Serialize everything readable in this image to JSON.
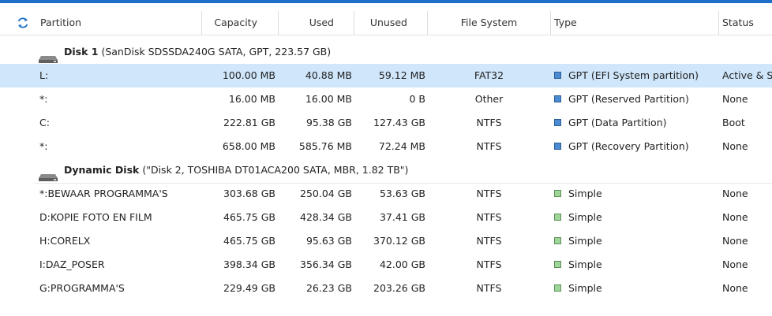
{
  "header": {
    "columns": [
      "Partition",
      "Capacity",
      "Used",
      "Unused",
      "File System",
      "Type",
      "Status"
    ]
  },
  "icons": {
    "refresh": "refresh-icon",
    "disk": "disk-drive-icon",
    "partition_type": "square-icon"
  },
  "colors": {
    "accent": "#1e6fc9",
    "gpt_square": "#4b8bd4",
    "simple_square": "#9fd79a",
    "selection": "#cfe6fb"
  },
  "disks": [
    {
      "name": "Disk 1",
      "details": "(SanDisk SDSSDA240G SATA, GPT, 223.57 GB)",
      "partitions": [
        {
          "partition": "L:",
          "capacity": "100.00 MB",
          "used": "40.88 MB",
          "unused": "59.12 MB",
          "fs": "FAT32",
          "type": "GPT (EFI System partition)",
          "status": "Active & Sy",
          "selected": true
        },
        {
          "partition": "*:",
          "capacity": "16.00 MB",
          "used": "16.00 MB",
          "unused": "0 B",
          "fs": "Other",
          "type": "GPT (Reserved Partition)",
          "status": "None"
        },
        {
          "partition": "C:",
          "capacity": "222.81 GB",
          "used": "95.38 GB",
          "unused": "127.43 GB",
          "fs": "NTFS",
          "type": "GPT (Data Partition)",
          "status": "Boot"
        },
        {
          "partition": "*:",
          "capacity": "658.00 MB",
          "used": "585.76 MB",
          "unused": "72.24 MB",
          "fs": "NTFS",
          "type": "GPT (Recovery Partition)",
          "status": "None"
        }
      ]
    },
    {
      "name": "Dynamic Disk",
      "details": "(\"Disk 2, TOSHIBA DT01ACA200 SATA, MBR, 1.82 TB\")",
      "partitions": [
        {
          "partition": "*:BEWAAR PROGRAMMA'S",
          "capacity": "303.68 GB",
          "used": "250.04 GB",
          "unused": "53.63 GB",
          "fs": "NTFS",
          "type": "Simple",
          "status": "None"
        },
        {
          "partition": "D:KOPIE FOTO EN FILM",
          "capacity": "465.75 GB",
          "used": "428.34 GB",
          "unused": "37.41 GB",
          "fs": "NTFS",
          "type": "Simple",
          "status": "None"
        },
        {
          "partition": "H:CORELX",
          "capacity": "465.75 GB",
          "used": "95.63 GB",
          "unused": "370.12 GB",
          "fs": "NTFS",
          "type": "Simple",
          "status": "None"
        },
        {
          "partition": "I:DAZ_POSER",
          "capacity": "398.34 GB",
          "used": "356.34 GB",
          "unused": "42.00 GB",
          "fs": "NTFS",
          "type": "Simple",
          "status": "None"
        },
        {
          "partition": "G:PROGRAMMA'S",
          "capacity": "229.49 GB",
          "used": "26.23 GB",
          "unused": "203.26 GB",
          "fs": "NTFS",
          "type": "Simple",
          "status": "None"
        }
      ]
    }
  ]
}
